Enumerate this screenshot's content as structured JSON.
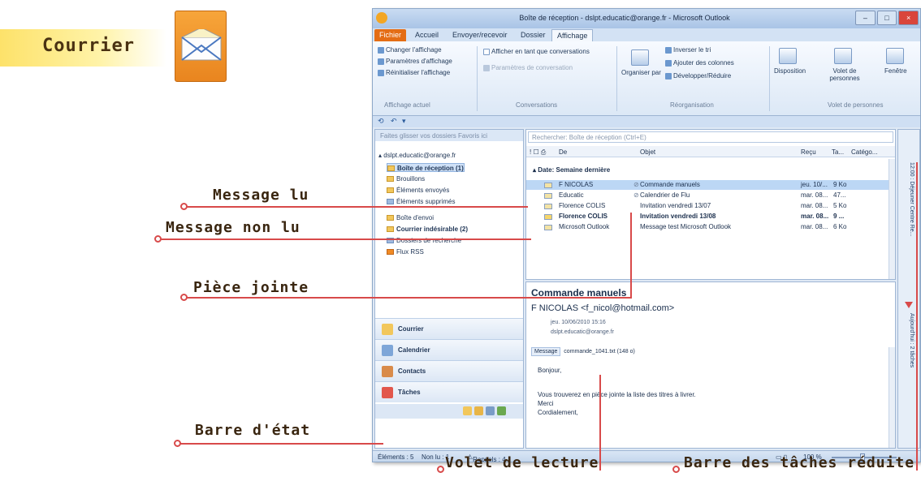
{
  "heading": {
    "title": "Courrier",
    "icon": "envelope-icon"
  },
  "callouts": {
    "read_message": "Message lu",
    "unread_message": "Message non lu",
    "attachment": "Pièce jointe",
    "status_bar": "Barre d'état",
    "reading_pane": "Volet de lecture",
    "todo_bar": "Barre des tâches réduite"
  },
  "window": {
    "title": "Boîte de réception - dslpt.educatic@orange.fr - Microsoft Outlook",
    "tabs": [
      "Fichier",
      "Accueil",
      "Envoyer/recevoir",
      "Dossier",
      "Affichage"
    ],
    "active_tab": "Affichage",
    "ribbon": {
      "current_view": [
        "Changer l'affichage",
        "Paramètres d'affichage",
        "Réinitialiser l'affichage"
      ],
      "current_view_group": "Affichage actuel",
      "conversations": [
        "Afficher en tant que conversations",
        "Paramètres de conversation"
      ],
      "conversations_group": "Conversations",
      "arrange_label": "Organiser par",
      "arrangement": [
        "Inverser le tri",
        "Ajouter des colonnes",
        "Développer/Réduire"
      ],
      "arrangement_group": "Réorganisation",
      "layout_buttons": [
        "Disposition",
        "Volet de personnes",
        "Fenêtre"
      ],
      "people_group": "Volet de personnes"
    },
    "nav": {
      "header": "Faites glisser vos dossiers Favoris ici",
      "account": "dslpt.educatic@orange.fr",
      "folders": [
        {
          "label": "Boîte de réception (1)",
          "bold": true,
          "selected": true
        },
        {
          "label": "Brouillons",
          "bold": false,
          "selected": false
        },
        {
          "label": "Éléments envoyés",
          "bold": false,
          "selected": false
        },
        {
          "label": "Éléments supprimés",
          "bold": false,
          "selected": false
        },
        {
          "label": "Boîte d'envoi",
          "bold": false,
          "selected": false
        },
        {
          "label": "Courrier indésirable (2)",
          "bold": true,
          "selected": false
        },
        {
          "label": "Dossiers de recherche",
          "bold": false,
          "selected": false
        },
        {
          "label": "Flux RSS",
          "bold": false,
          "selected": false
        }
      ],
      "buttons": [
        "Courrier",
        "Calendrier",
        "Contacts",
        "Tâches"
      ]
    },
    "list": {
      "search_placeholder": "Rechercher: Boîte de réception (Ctrl+E)",
      "columns": {
        "from": "De",
        "subject": "Objet",
        "received": "Reçu",
        "size": "Ta...",
        "category": "Catégo..."
      },
      "group": "Date: Semaine dernière",
      "rows": [
        {
          "from": "F NICOLAS",
          "subject": "Commande manuels",
          "date": "jeu. 10/...",
          "size": "9 Ko",
          "attachment": true,
          "unread": false,
          "selected": true
        },
        {
          "from": "Educatic",
          "subject": "Calendrier de Flu",
          "date": "mar. 08...",
          "size": "47...",
          "attachment": true,
          "unread": false,
          "selected": false
        },
        {
          "from": "Florence COLIS",
          "subject": "Invitation vendredi 13/07",
          "date": "mar. 08...",
          "size": "5 Ko",
          "attachment": false,
          "unread": false,
          "selected": false
        },
        {
          "from": "Florence COLIS",
          "subject": "Invitation vendredi 13/08",
          "date": "mar. 08...",
          "size": "9 ...",
          "attachment": false,
          "unread": true,
          "selected": false
        },
        {
          "from": "Microsoft Outlook",
          "subject": "Message test Microsoft Outlook",
          "date": "mar. 08...",
          "size": "6 Ko",
          "attachment": false,
          "unread": false,
          "selected": false
        }
      ]
    },
    "reader": {
      "subject": "Commande manuels",
      "from": "F NICOLAS <f_nicol@hotmail.com>",
      "sent": "jeu. 10/06/2010 15:16",
      "to": "dslpt.educatic@orange.fr",
      "message_tab": "Message",
      "attachment_file": "commande_1041.txt (148 o)",
      "body": [
        "Bonjour,",
        "Vous trouverez en pièce jointe la liste des titres à livrer.",
        "Merci",
        "Cordialement,"
      ]
    },
    "todo_bar": {
      "appointment": "12:00 : Déjeuner Centre Re...",
      "tasks": "Aujourd'hui : 2 tâches"
    },
    "status": {
      "items": "Éléments : 5",
      "unread": "Non lu : 1",
      "reminders": "Rappels : 4",
      "zoom": "100 %"
    }
  },
  "colors": {
    "accent": "#e46d15",
    "callout_line": "#d84a4a",
    "selection": "#bcd7f5"
  }
}
